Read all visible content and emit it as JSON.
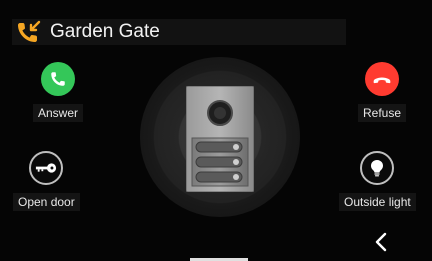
{
  "header": {
    "title": "Garden Gate",
    "icon": "incoming-call-icon"
  },
  "actions": {
    "answer": {
      "label": "Answer",
      "icon": "phone-icon",
      "color": "#34c759"
    },
    "refuse": {
      "label": "Refuse",
      "icon": "hang-up-icon",
      "color": "#ff3b30"
    },
    "open_door": {
      "label": "Open door",
      "icon": "key-icon"
    },
    "outside_light": {
      "label": "Outside light",
      "icon": "light-bulb-icon"
    }
  },
  "navigation": {
    "back_icon": "chevron-left-icon"
  },
  "colors": {
    "background": "#050505",
    "accent": "#f5a623"
  }
}
